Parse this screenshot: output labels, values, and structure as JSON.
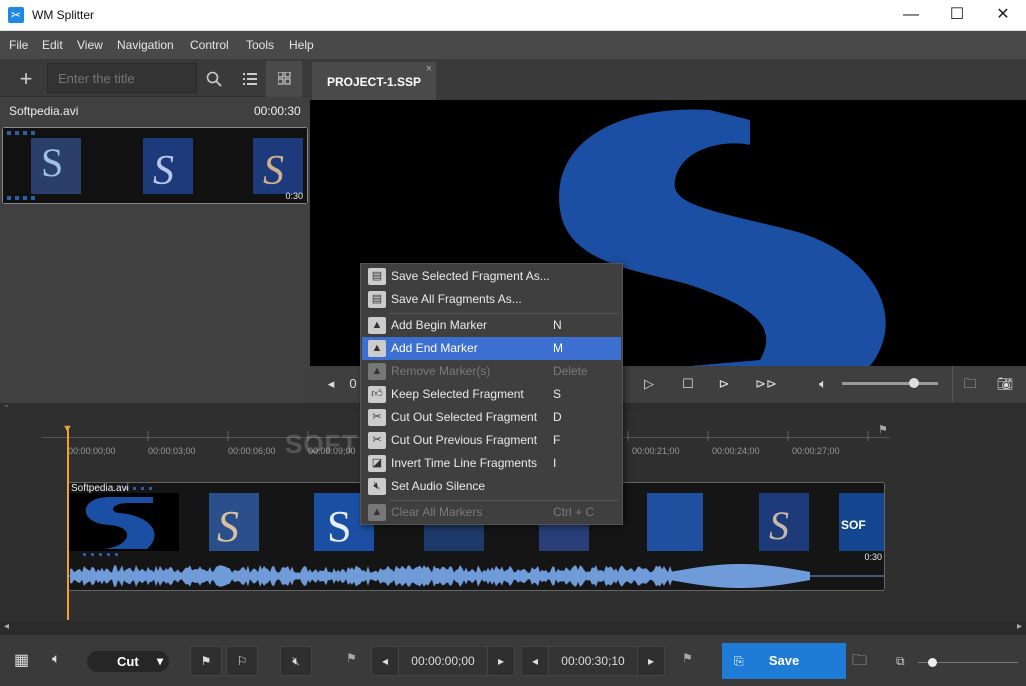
{
  "window": {
    "title": "WM Splitter",
    "minimize": "—",
    "maximize": "☐",
    "close": "✕"
  },
  "menu": [
    "File",
    "Edit",
    "View",
    "Navigation",
    "Control",
    "Tools",
    "Help"
  ],
  "library": {
    "add": "+",
    "search_placeholder": "Enter the title",
    "file_name": "Softpedia.avi",
    "file_duration": "00:00:30",
    "clip_badge": "0:30"
  },
  "project": {
    "tab_label": "PROJECT-1.SSP",
    "tab_close": "×"
  },
  "player": {
    "timecode_partial": "0",
    "volume_level": 0.75
  },
  "context_menu": {
    "items": [
      {
        "label": "Save Selected Fragment As...",
        "key": "",
        "state": "normal",
        "icon": "save-fragment-icon"
      },
      {
        "label": "Save All Fragments As...",
        "key": "",
        "state": "normal",
        "icon": "save-all-icon"
      },
      {
        "label": "Add Begin Marker",
        "key": "N",
        "state": "normal",
        "icon": "begin-marker-icon"
      },
      {
        "label": "Add End Marker",
        "key": "M",
        "state": "selected",
        "icon": "end-marker-icon"
      },
      {
        "label": "Remove Marker(s)",
        "key": "Delete",
        "state": "disabled",
        "icon": "remove-marker-icon"
      },
      {
        "label": "Keep Selected Fragment",
        "key": "S",
        "state": "normal",
        "icon": "thumb-up-icon"
      },
      {
        "label": "Cut Out Selected Fragment",
        "key": "D",
        "state": "normal",
        "icon": "cut-selected-icon"
      },
      {
        "label": "Cut Out Previous Fragment",
        "key": "F",
        "state": "normal",
        "icon": "cut-previous-icon"
      },
      {
        "label": "Invert Time Line Fragments",
        "key": "I",
        "state": "normal",
        "icon": "invert-icon"
      },
      {
        "label": "Set Audio Silence",
        "key": "",
        "state": "normal",
        "icon": "mute-icon"
      },
      {
        "label": "Clear All Markers",
        "key": "Ctrl + C",
        "state": "disabled",
        "icon": "clear-markers-icon"
      }
    ]
  },
  "timeline": {
    "ruler": [
      "00:00:00;00",
      "00:00:03;00",
      "00:00:06;00",
      "00:00:09;00",
      "00:00:21;00",
      "00:00:24;00",
      "00:00:27;00"
    ],
    "clip_label": "Softpedia.avi",
    "clip_badge": "0:30",
    "watermark": "SOFTPEDIA"
  },
  "bottom": {
    "mode": "Cut",
    "mode_caret": "▾",
    "start_time": "00:00:00;00",
    "end_time": "00:00:30;10",
    "save_label": "Save",
    "zoom_level": 0.15
  },
  "colors": {
    "accent": "#1e7cd6",
    "selection": "#3b6fd0",
    "playhead": "#e8a33a",
    "waveform": "#6f9bd9"
  }
}
